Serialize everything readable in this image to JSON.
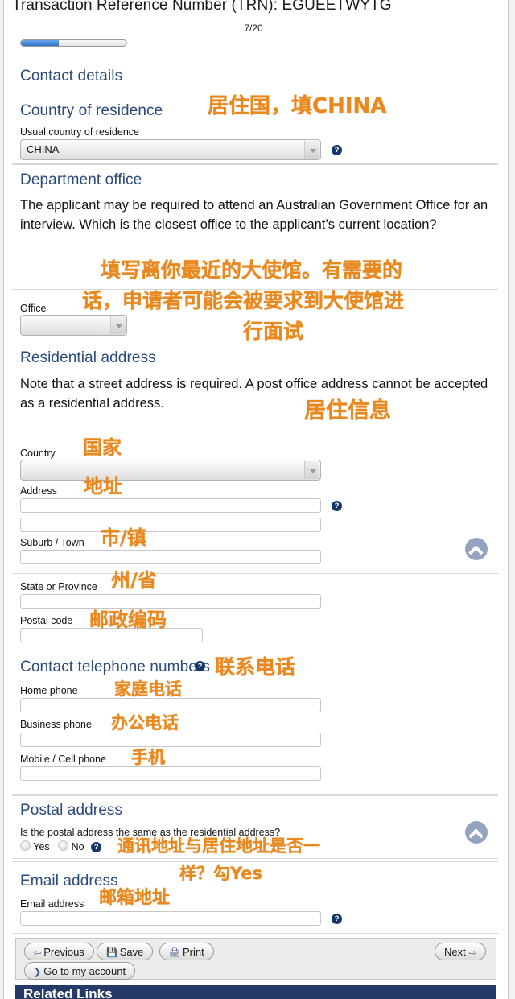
{
  "header": {
    "trn_text": "Transaction Reference Number (TRN): EGUEETWYTG",
    "page_counter": "7/20",
    "progress_percent": 36
  },
  "sections": {
    "contact_details": {
      "heading": "Contact details"
    },
    "country_of_residence": {
      "heading": "Country of residence",
      "field_label": "Usual country of residence",
      "value": "CHINA",
      "help_glyph": "?",
      "annotation": "居住国，填CHINA"
    },
    "department_office": {
      "heading": "Department office",
      "body": "The applicant may be required to attend an Australian Government Office for an interview. Which is the closest office to the applicant’s current location?",
      "annotation_line1": "填写离你最近的大使馆。有需要的",
      "annotation_line2": "话，申请者可能会被要求到大使馆进",
      "annotation_line3": "行面试",
      "office_label": "Office",
      "office_value": ""
    },
    "residential_address": {
      "heading": "Residential address",
      "body": "Note that a street address is required. A post office address cannot be accepted as a residential address.",
      "annotation": "居住信息",
      "country_label": "Country",
      "country_annotation": "国家",
      "country_value": "",
      "address_label": "Address",
      "address_annotation": "地址",
      "address_line1": "",
      "address_line2": "",
      "suburb_label": "Suburb / Town",
      "suburb_annotation": "市/镇",
      "suburb_value": "",
      "state_label": "State or Province",
      "state_annotation": "州/省",
      "state_value": "",
      "postal_label": "Postal code",
      "postal_annotation": "邮政编码",
      "postal_value": ""
    },
    "contact_telephone": {
      "heading": "Contact telephone numbers",
      "annotation": "联系电话",
      "home_label": "Home phone",
      "home_annotation": "家庭电话",
      "home_value": "",
      "business_label": "Business phone",
      "business_annotation": "办公电话",
      "business_value": "",
      "mobile_label": "Mobile / Cell phone",
      "mobile_annotation": "手机",
      "mobile_value": ""
    },
    "postal_address": {
      "heading": "Postal address",
      "question": "Is the postal address the same as the residential address?",
      "option_yes": "Yes",
      "option_no": "No",
      "annotation_line1": "通讯地址与居住地址是否一",
      "annotation_line2": "样？勾Yes"
    },
    "email_address": {
      "heading": "Email address",
      "field_label": "Email address",
      "annotation": "邮箱地址",
      "value": ""
    }
  },
  "footer": {
    "previous": "Previous",
    "save": "Save",
    "print": "Print",
    "next": "Next",
    "go_to_my_account": "Go to my account",
    "related_links": "Related Links"
  },
  "colors": {
    "heading_blue": "#2b4a7d",
    "annotation_orange": "#E8881F",
    "progress_blue": "#2f74cc",
    "related_links_bar": "#253a67"
  }
}
